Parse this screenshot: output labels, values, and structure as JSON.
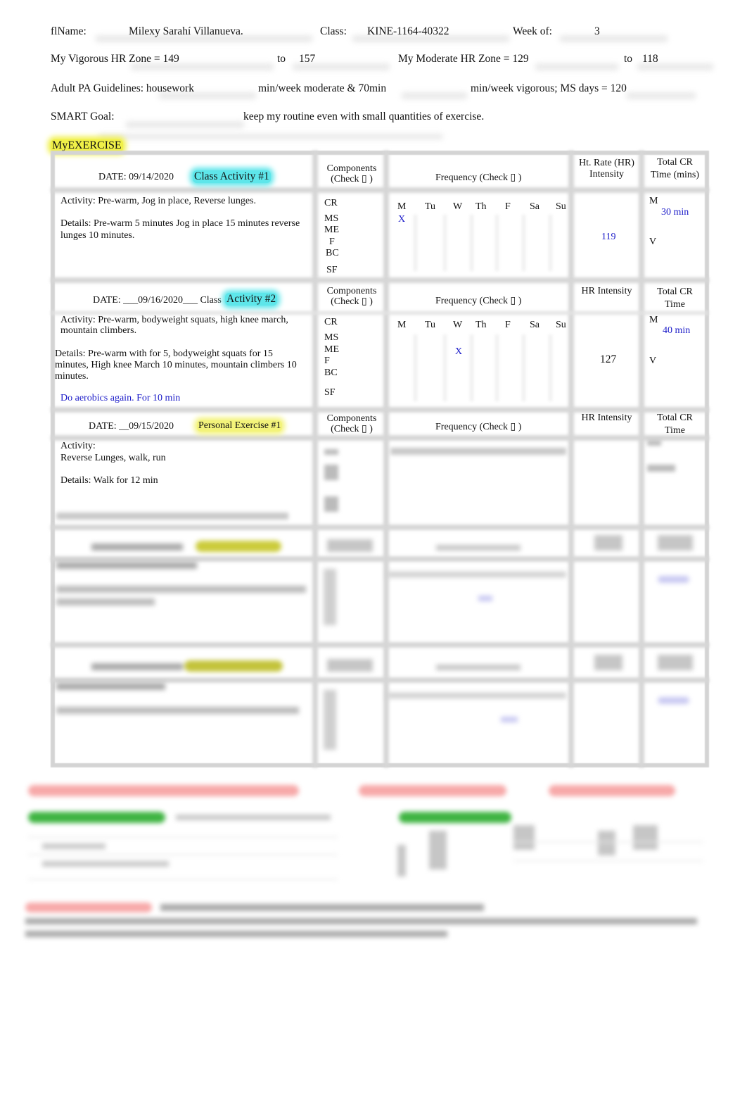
{
  "header": {
    "name_label": "flName:",
    "name_value": "Milexy Sarahí Villanueva.",
    "class_label": "Class:",
    "class_value": "KINE-1164-40322",
    "week_label": "Week of:",
    "week_value": "3",
    "vigorous_label": "My Vigorous  HR Zone = 149",
    "vigorous_to": "to",
    "vigorous_max": "157",
    "moderate_label": "My Moderate  HR Zone = 129",
    "moderate_to": "to",
    "moderate_max": "118",
    "guidelines_prefix": "Adult PA Guidelines: housework",
    "guidelines_mid": "min/week moderate & 70min",
    "guidelines_suffix": "min/week vigorous; MS days = 120",
    "smart_label": "SMART Goal:",
    "smart_value": "keep my routine even with small quantities of exercise."
  },
  "section_title": "MyEXERCISE",
  "common": {
    "components_header": "Components",
    "components_check": "(Check  ▯ )",
    "frequency_header": "Frequency (Check   ▯ )",
    "hr_header_1": "Ht. Rate (HR) Intensity",
    "hr_header": "HR Intensity",
    "time_header_1": "Total CR Time (mins)",
    "time_header": "Total CR Time",
    "components": [
      "CR",
      "MS",
      "ME",
      "F",
      "BC",
      "SF"
    ],
    "days": [
      "M",
      "Tu",
      "W",
      "Th",
      "F",
      "Sa",
      "Su"
    ],
    "mod_label": "M",
    "vig_label": "V"
  },
  "entries": [
    {
      "date": "DATE:   09/14/2020",
      "tag": "Class Activity   #1",
      "activity": "Activity:   Pre-warm, Jog in place, Reverse lunges.",
      "details": "Details:   Pre-warm 5 minutes Jog in place 15 minutes reverse lunges 10 minutes.",
      "checked_day": "M",
      "mark": "X",
      "hr": "119",
      "moderate_time": "30 min"
    },
    {
      "date": "DATE: ___09/16/2020___ Class",
      "tag": "Activity  #2",
      "activity": "Activity:   Pre-warm, bodyweight squats, high knee march, mountain climbers.",
      "details": "Details: Pre-warm with for 5, bodyweight squats for 15 minutes, High knee March 10 minutes, mountain climbers 10 minutes.",
      "note": "Do aerobics again. For 10 min",
      "checked_day": "W",
      "mark": "X",
      "hr": "127",
      "moderate_time": "40 min"
    },
    {
      "date": "DATE: __09/15/2020",
      "tag": "Personal Exercise #1",
      "activity": "Activity:",
      "activity_value": "Reverse Lunges, walk, run",
      "details": "Details: Walk for 12 min"
    }
  ]
}
